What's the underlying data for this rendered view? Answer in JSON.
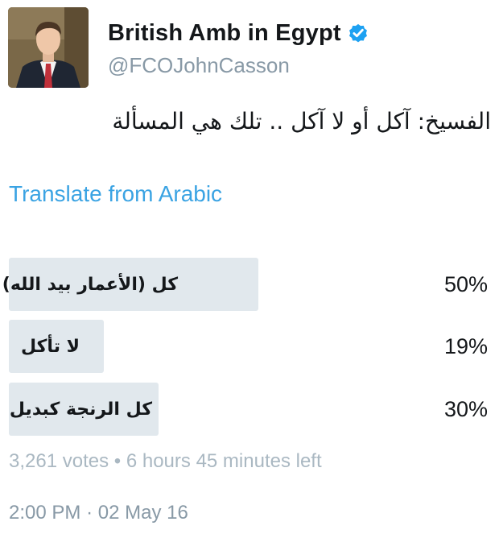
{
  "author": {
    "display_name": "British Amb in Egypt",
    "handle": "@FCOJohnCasson",
    "verified_icon": "verified-badge-icon",
    "avatar_icon": "profile-photo"
  },
  "tweet": {
    "text": "الفسيخ: آكل أو لا آكل .. تلك هي المسألة",
    "translate_label": "Translate from Arabic"
  },
  "poll": {
    "options": [
      {
        "label": "كل (الأعمار بيد الله)",
        "percent_label": "50%",
        "percent": 50
      },
      {
        "label": "لا تأكل",
        "percent_label": "19%",
        "percent": 19
      },
      {
        "label": "كل الرنجة كبديل",
        "percent_label": "30%",
        "percent": 30
      }
    ],
    "votes_label": "3,261 votes",
    "separator": "•",
    "time_left": "6 hours 45 minutes left"
  },
  "timestamp": {
    "time": "2:00 PM",
    "separator": "·",
    "date": "02 May 16"
  },
  "colors": {
    "link": "#3aa3e3",
    "bar": "#e1e8ed",
    "muted": "#aab8c2",
    "verified": "#1da1f2"
  }
}
